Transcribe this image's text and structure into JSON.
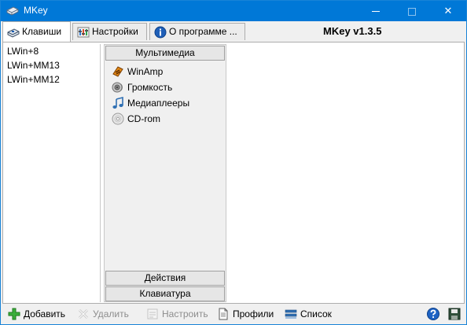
{
  "window": {
    "title": "MKey",
    "minimize_symbol": "—",
    "close_symbol": "✕"
  },
  "tabs": [
    {
      "label": "Клавиши",
      "icon": "keyboard-icon",
      "active": true
    },
    {
      "label": "Настройки",
      "icon": "settings-icon",
      "active": false
    },
    {
      "label": "О программе ...",
      "icon": "info-icon",
      "active": false
    }
  ],
  "version_label": "MKey v1.3.5",
  "key_list": [
    "LWin+8",
    "LWin+MM13",
    "LWin+MM12"
  ],
  "categories": {
    "multimedia": {
      "header": "Мультимедиа",
      "items": [
        {
          "label": "WinAmp",
          "icon": "winamp-icon"
        },
        {
          "label": "Громкость",
          "icon": "speaker-icon"
        },
        {
          "label": "Медиаплееры",
          "icon": "music-note-icon"
        },
        {
          "label": "CD-rom",
          "icon": "cd-icon"
        }
      ]
    },
    "actions_header": "Действия",
    "keyboard_header": "Клавиатура"
  },
  "toolbar": {
    "add": "Добавить",
    "delete": "Удалить",
    "configure": "Настроить",
    "profiles": "Профили",
    "list": "Список",
    "help_icon": "help-icon",
    "save_icon": "save-icon"
  },
  "colors": {
    "titlebar": "#0078d7",
    "window_bg": "#f0f0f0",
    "panel_bg": "#ffffff",
    "disabled_text": "#8d8d8d"
  }
}
